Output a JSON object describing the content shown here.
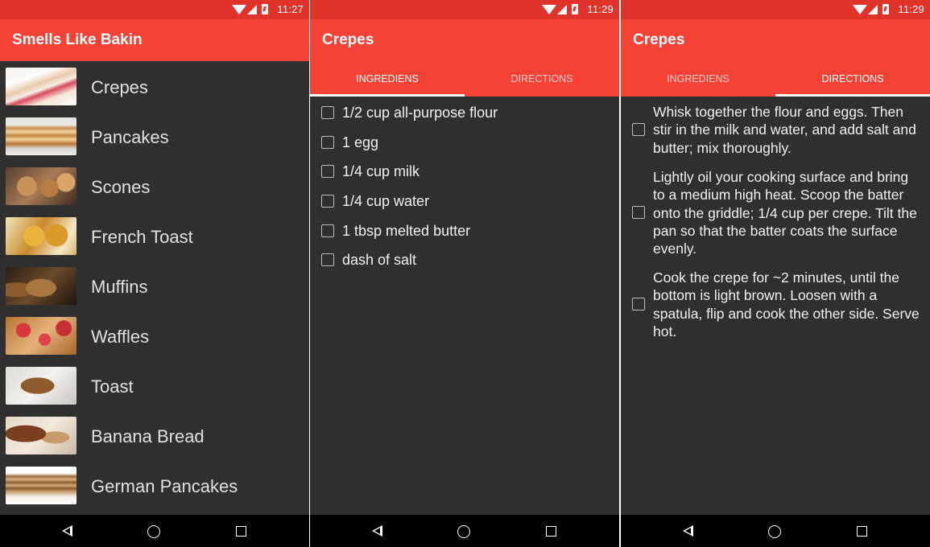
{
  "screens": [
    {
      "status_time": "11:27",
      "app_title": "Smells Like Bakin",
      "recipes": [
        {
          "name": "Crepes",
          "thumb": "crepes-photo"
        },
        {
          "name": "Pancakes",
          "thumb": "pancakes-photo"
        },
        {
          "name": "Scones",
          "thumb": "scones-photo"
        },
        {
          "name": "French Toast",
          "thumb": "french-toast-photo"
        },
        {
          "name": "Muffins",
          "thumb": "muffins-photo"
        },
        {
          "name": "Waffles",
          "thumb": "waffles-photo"
        },
        {
          "name": "Toast",
          "thumb": "toast-photo"
        },
        {
          "name": "Banana Bread",
          "thumb": "banana-bread-photo"
        },
        {
          "name": "German Pancakes",
          "thumb": "german-pancakes-photo"
        }
      ]
    },
    {
      "status_time": "11:29",
      "app_title": "Crepes",
      "tabs": [
        "INGREDIENS",
        "DIRECTIONS"
      ],
      "active_tab": "INGREDIENS",
      "ingredients": [
        "1/2 cup all-purpose flour",
        "1 egg",
        "1/4 cup milk",
        "1/4 cup water",
        "1 tbsp melted butter",
        "dash of salt"
      ]
    },
    {
      "status_time": "11:29",
      "app_title": "Crepes",
      "tabs": [
        "INGREDIENS",
        "DIRECTIONS"
      ],
      "active_tab": "DIRECTIONS",
      "directions": [
        "Whisk together the flour and eggs. Then stir in the milk and water, and add salt and butter; mix thoroughly.",
        "Lightly oil your cooking surface and bring to a medium high heat. Scoop the batter onto the griddle; 1/4 cup per crepe. Tilt the pan so that the batter coats the surface evenly.",
        "Cook the crepe for ~2 minutes, until the bottom is light brown. Loosen with a spatula, flip and cook the other side. Serve hot."
      ]
    }
  ],
  "colors": {
    "status_bar": "#e0332a",
    "app_bar": "#f44336",
    "background": "#303030",
    "nav_bar": "#000000"
  }
}
